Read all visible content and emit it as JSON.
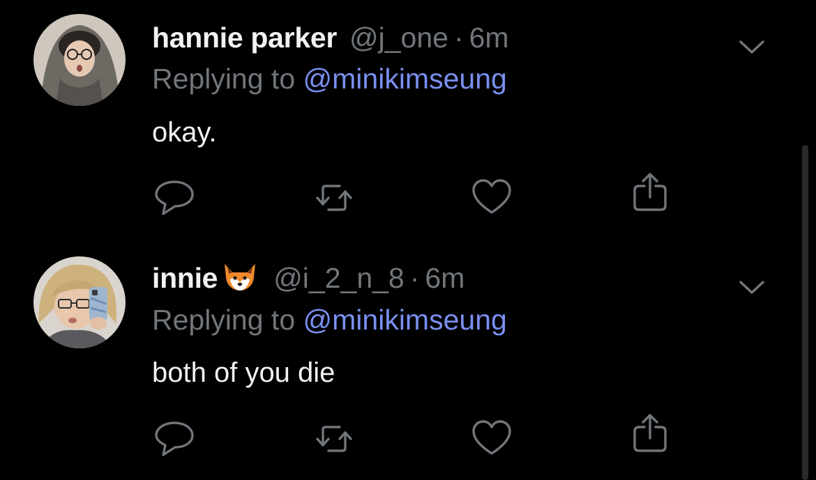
{
  "tweets": [
    {
      "display_name": "hannie parker",
      "name_emoji": "",
      "handle": "@j_one",
      "separator": "·",
      "time": "6m",
      "replying_prefix": "Replying to",
      "replying_to": "@minikimseung",
      "text": "okay.",
      "avatar_icon": "avatar-photo",
      "actions": [
        "reply-icon",
        "retweet-icon",
        "like-icon",
        "share-icon"
      ]
    },
    {
      "display_name": "innie",
      "name_emoji": "🦊",
      "handle": "@i_2_n_8",
      "separator": "·",
      "time": "6m",
      "replying_prefix": "Replying to",
      "replying_to": "@minikimseung",
      "text": "both of you die",
      "avatar_icon": "avatar-photo",
      "actions": [
        "reply-icon",
        "retweet-icon",
        "like-icon",
        "share-icon"
      ]
    }
  ],
  "colors": {
    "background": "#000000",
    "primary_text": "#f2f2f2",
    "secondary_text": "#71767b",
    "mention": "#7b8ff0",
    "icon": "#71767b"
  }
}
